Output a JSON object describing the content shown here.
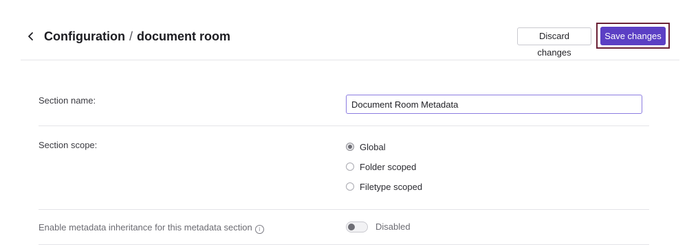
{
  "header": {
    "title_section": "Configuration",
    "title_separator": "/",
    "title_page": "document room",
    "discard_label": "Discard changes",
    "save_label": "Save changes",
    "back_icon": "chevron-left-icon"
  },
  "form": {
    "section_name": {
      "label": "Section name:",
      "value": "Document Room Metadata"
    },
    "section_scope": {
      "label": "Section scope:",
      "options": [
        {
          "label": "Global",
          "checked": true
        },
        {
          "label": "Folder scoped",
          "checked": false
        },
        {
          "label": "Filetype scoped",
          "checked": false
        }
      ]
    },
    "inheritance": {
      "label": "Enable metadata inheritance for this metadata section",
      "info_icon": "info-icon",
      "status": "Disabled",
      "enabled": false
    }
  },
  "colors": {
    "accent": "#5b3fc4",
    "highlight_outline": "#6b2136",
    "input_border": "#8b7be0",
    "divider": "#e4e4e8"
  }
}
